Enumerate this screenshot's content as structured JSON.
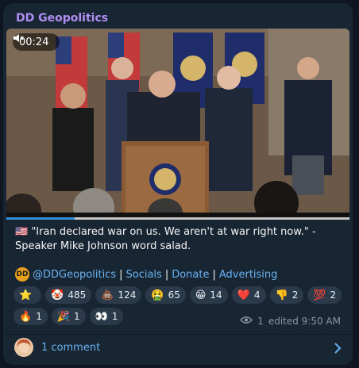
{
  "post": {
    "channel_name": "DD Geopolitics",
    "video": {
      "time": "00:24",
      "muted_icon": "speaker-muted-icon",
      "progress": 0.2
    },
    "caption_flag": "🇺🇸",
    "caption": "\"Iran declared war on us. We aren't at war right now.\" - Speaker Mike Johnson word salad.",
    "links": {
      "badge": "DD",
      "handle": "@DDGeopolitics",
      "sep1": "|",
      "socials": "Socials",
      "sep2": "|",
      "donate": "Donate",
      "sep3": "|",
      "advertising": "Advertising"
    },
    "reactions": [
      {
        "emoji": "⭐",
        "count": ""
      },
      {
        "emoji": "🤡",
        "count": "485"
      },
      {
        "emoji": "💩",
        "count": "124"
      },
      {
        "emoji": "🤮",
        "count": "65"
      },
      {
        "emoji": "😁",
        "count": "14"
      },
      {
        "emoji": "❤️",
        "count": "4"
      },
      {
        "emoji": "👎",
        "count": "2"
      },
      {
        "emoji": "💯",
        "count": "2"
      },
      {
        "emoji": "🔥",
        "count": "1"
      },
      {
        "emoji": "🎉",
        "count": "1"
      },
      {
        "emoji": "👀",
        "count": "1"
      }
    ],
    "meta": {
      "views": "1",
      "edited": "edited 9:50 AM"
    },
    "comments_label": "1 comment"
  },
  "colors": {
    "background": "#0e1621",
    "card": "#182533",
    "channel_name": "#b18ef5",
    "link": "#6ab3f3",
    "reaction_pill": "#2b3a4b"
  }
}
